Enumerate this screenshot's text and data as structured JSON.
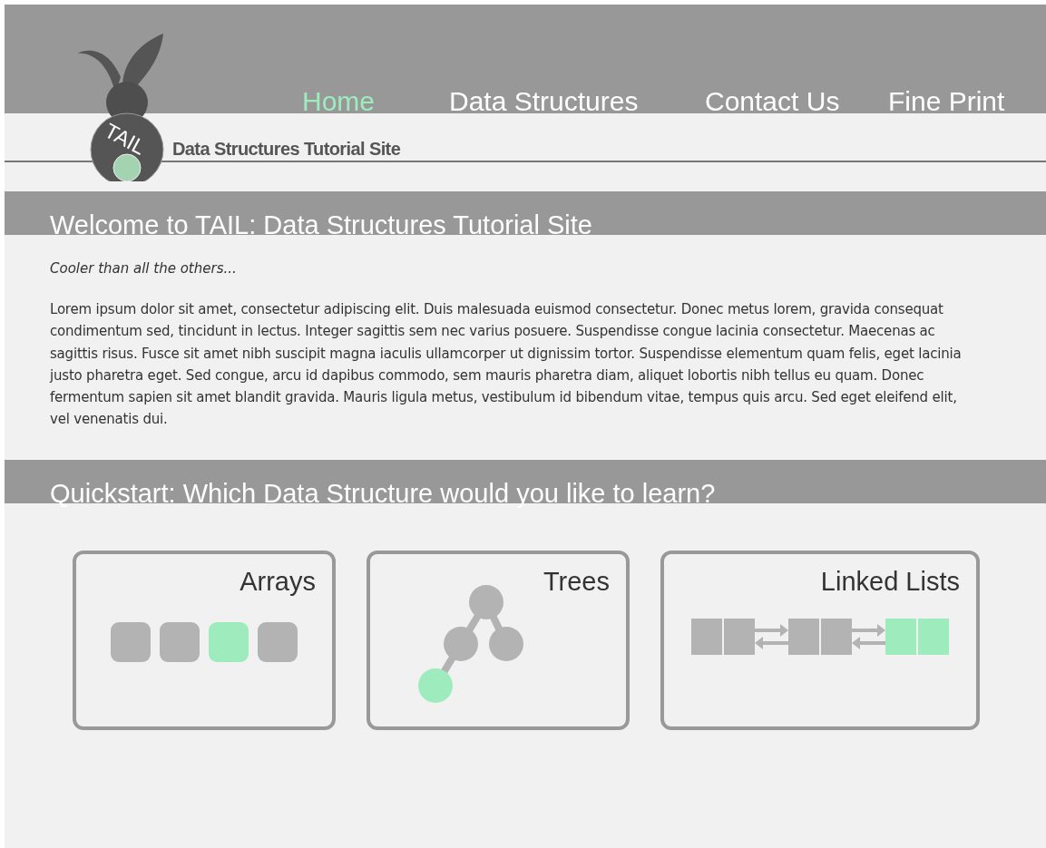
{
  "logo": {
    "text": "TAIL",
    "site_name": "Data Structures Tutorial Site"
  },
  "nav": [
    {
      "label": "Home",
      "selected": true
    },
    {
      "label": "Data Structures",
      "selected": false
    },
    {
      "label": "Contact Us",
      "selected": false
    },
    {
      "label": "Fine Print",
      "selected": false
    }
  ],
  "welcome": {
    "title": "Welcome to TAIL: Data Structures Tutorial Site",
    "tagline": "Cooler than all the others...",
    "body": "Lorem ipsum dolor sit amet, consectetur adipiscing elit. Duis malesuada euismod consectetur. Donec metus lorem, gravida consequat condimentum sed, tincidunt in lectus. Integer sagittis sem nec varius posuere. Suspendisse congue lacinia consectetur. Maecenas ac sagittis risus. Fusce sit amet nibh suscipit magna iaculis ullamcorper ut dignissim tortor. Suspendisse elementum quam felis, eget lacinia justo pharetra eget. Sed congue, arcu id dapibus commodo, sem mauris pharetra diam, aliquet lobortis nibh tellus eu quam. Donec fermentum sapien sit amet blandit gravida. Mauris ligula metus, vestibulum id bibendum vitae, tempus quis arcu. Sed eget eleifend elit, vel venenatis dui."
  },
  "quickstart": {
    "title": "Quickstart: Which Data Structure would you like to learn?",
    "cards": [
      {
        "title": "Arrays",
        "kind": "array"
      },
      {
        "title": "Trees",
        "kind": "tree"
      },
      {
        "title": "Linked Lists",
        "kind": "linked_list"
      }
    ]
  }
}
